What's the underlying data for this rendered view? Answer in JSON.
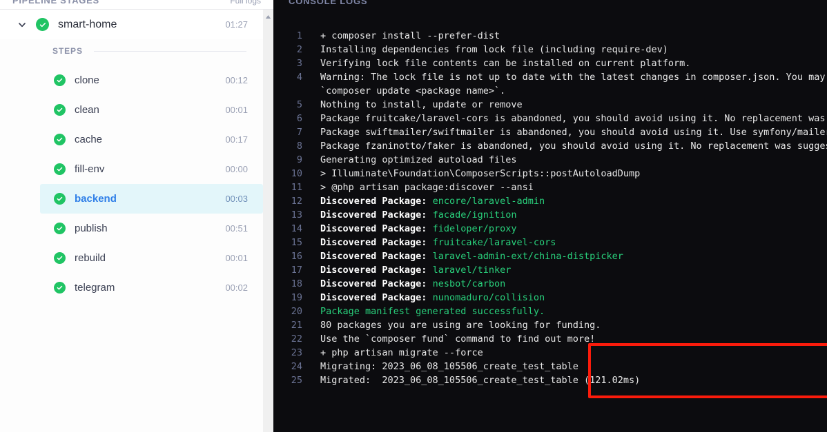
{
  "left_panel": {
    "header_title": "PIPELINE STAGES",
    "header_action": "Full logs"
  },
  "pipeline": {
    "chevron_icon": "chevron-down-icon",
    "status_icon": "check-circle-icon",
    "name": "smart-home",
    "duration": "01:27",
    "steps_label": "STEPS",
    "steps": [
      {
        "name": "clone",
        "duration": "00:12",
        "status": "success",
        "active": false
      },
      {
        "name": "clean",
        "duration": "00:01",
        "status": "success",
        "active": false
      },
      {
        "name": "cache",
        "duration": "00:17",
        "status": "success",
        "active": false
      },
      {
        "name": "fill-env",
        "duration": "00:00",
        "status": "success",
        "active": false
      },
      {
        "name": "backend",
        "duration": "00:03",
        "status": "success",
        "active": true
      },
      {
        "name": "publish",
        "duration": "00:51",
        "status": "success",
        "active": false
      },
      {
        "name": "rebuild",
        "duration": "00:01",
        "status": "success",
        "active": false
      },
      {
        "name": "telegram",
        "duration": "00:02",
        "status": "success",
        "active": false
      }
    ]
  },
  "scrollbar": {
    "up_arrow_icon": "scroll-up-arrow-icon"
  },
  "right_panel": {
    "header_title": "CONSOLE LOGS"
  },
  "console": {
    "lines": [
      {
        "num": "1",
        "text": "+ composer install --prefer-dist",
        "style": "plain"
      },
      {
        "num": "2",
        "text": "Installing dependencies from lock file (including require-dev)",
        "style": "plain"
      },
      {
        "num": "3",
        "text": "Verifying lock file contents can be installed on current platform.",
        "style": "plain"
      },
      {
        "num": "4",
        "text": "Warning: The lock file is not up to date with the latest changes in composer.json. You may be getti",
        "style": "plain"
      },
      {
        "num": "",
        "text": "`composer update <package name>`.",
        "style": "plain"
      },
      {
        "num": "5",
        "text": "Nothing to install, update or remove",
        "style": "plain"
      },
      {
        "num": "6",
        "text": "Package fruitcake/laravel-cors is abandoned, you should avoid using it. No replacement was suggeste",
        "style": "plain"
      },
      {
        "num": "7",
        "text": "Package swiftmailer/swiftmailer is abandoned, you should avoid using it. Use symfony/mailer instead",
        "style": "plain"
      },
      {
        "num": "8",
        "text": "Package fzaninotto/faker is abandoned, you should avoid using it. No replacement was suggested.",
        "style": "plain"
      },
      {
        "num": "9",
        "text": "Generating optimized autoload files",
        "style": "plain"
      },
      {
        "num": "10",
        "text": "> Illuminate\\Foundation\\ComposerScripts::postAutoloadDump",
        "style": "plain"
      },
      {
        "num": "11",
        "text": "> @php artisan package:discover --ansi",
        "style": "plain"
      },
      {
        "num": "12",
        "prefix": "Discovered Package: ",
        "pkg": "encore/laravel-admin",
        "style": "package"
      },
      {
        "num": "13",
        "prefix": "Discovered Package: ",
        "pkg": "facade/ignition",
        "style": "package"
      },
      {
        "num": "14",
        "prefix": "Discovered Package: ",
        "pkg": "fideloper/proxy",
        "style": "package"
      },
      {
        "num": "15",
        "prefix": "Discovered Package: ",
        "pkg": "fruitcake/laravel-cors",
        "style": "package"
      },
      {
        "num": "16",
        "prefix": "Discovered Package: ",
        "pkg": "laravel-admin-ext/china-distpicker",
        "style": "package"
      },
      {
        "num": "17",
        "prefix": "Discovered Package: ",
        "pkg": "laravel/tinker",
        "style": "package"
      },
      {
        "num": "18",
        "prefix": "Discovered Package: ",
        "pkg": "nesbot/carbon",
        "style": "package"
      },
      {
        "num": "19",
        "prefix": "Discovered Package: ",
        "pkg": "nunomaduro/collision",
        "style": "package"
      },
      {
        "num": "20",
        "text": "Package manifest generated successfully.",
        "style": "green"
      },
      {
        "num": "21",
        "text": "80 packages you are using are looking for funding.",
        "style": "plain"
      },
      {
        "num": "22",
        "text": "Use the `composer fund` command to find out more!",
        "style": "plain"
      },
      {
        "num": "23",
        "text": "+ php artisan migrate --force",
        "style": "plain"
      },
      {
        "num": "24",
        "text": "Migrating: 2023_06_08_105506_create_test_table",
        "style": "plain"
      },
      {
        "num": "25",
        "text": "Migrated:  2023_06_08_105506_create_test_table (121.02ms)",
        "style": "plain"
      }
    ]
  },
  "highlight": {
    "name": "migration-highlight-box",
    "color": "#fb1b0b"
  },
  "colors": {
    "success": "#20c464",
    "active_text": "#2f7fe8",
    "active_bg": "#e3f6fa",
    "console_bg": "#0c0c0f",
    "log_green": "#29d17c",
    "highlight": "#fb1b0b"
  }
}
